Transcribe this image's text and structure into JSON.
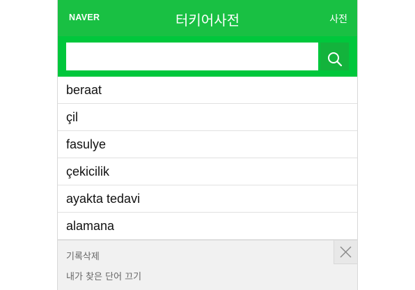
{
  "header": {
    "logo": "NAVER",
    "title": "터키어사전",
    "dictionary_link": "사전"
  },
  "search": {
    "value": "",
    "placeholder": "",
    "button_icon": "search-icon"
  },
  "results": [
    {
      "word": "beraat"
    },
    {
      "word": "çil"
    },
    {
      "word": "fasulye"
    },
    {
      "word": "çekicilik"
    },
    {
      "word": "ayakta tedavi"
    },
    {
      "word": "alamana"
    }
  ],
  "history_panel": {
    "delete_label": "기록삭제",
    "turn_off_label": "내가 찾은 단어 끄기",
    "close_icon": "close-icon"
  },
  "colors": {
    "header_bg": "#19c043",
    "search_bar_bg": "#00c73c",
    "search_button_bg": "#13b33c",
    "panel_bg": "#f1f1f1"
  }
}
